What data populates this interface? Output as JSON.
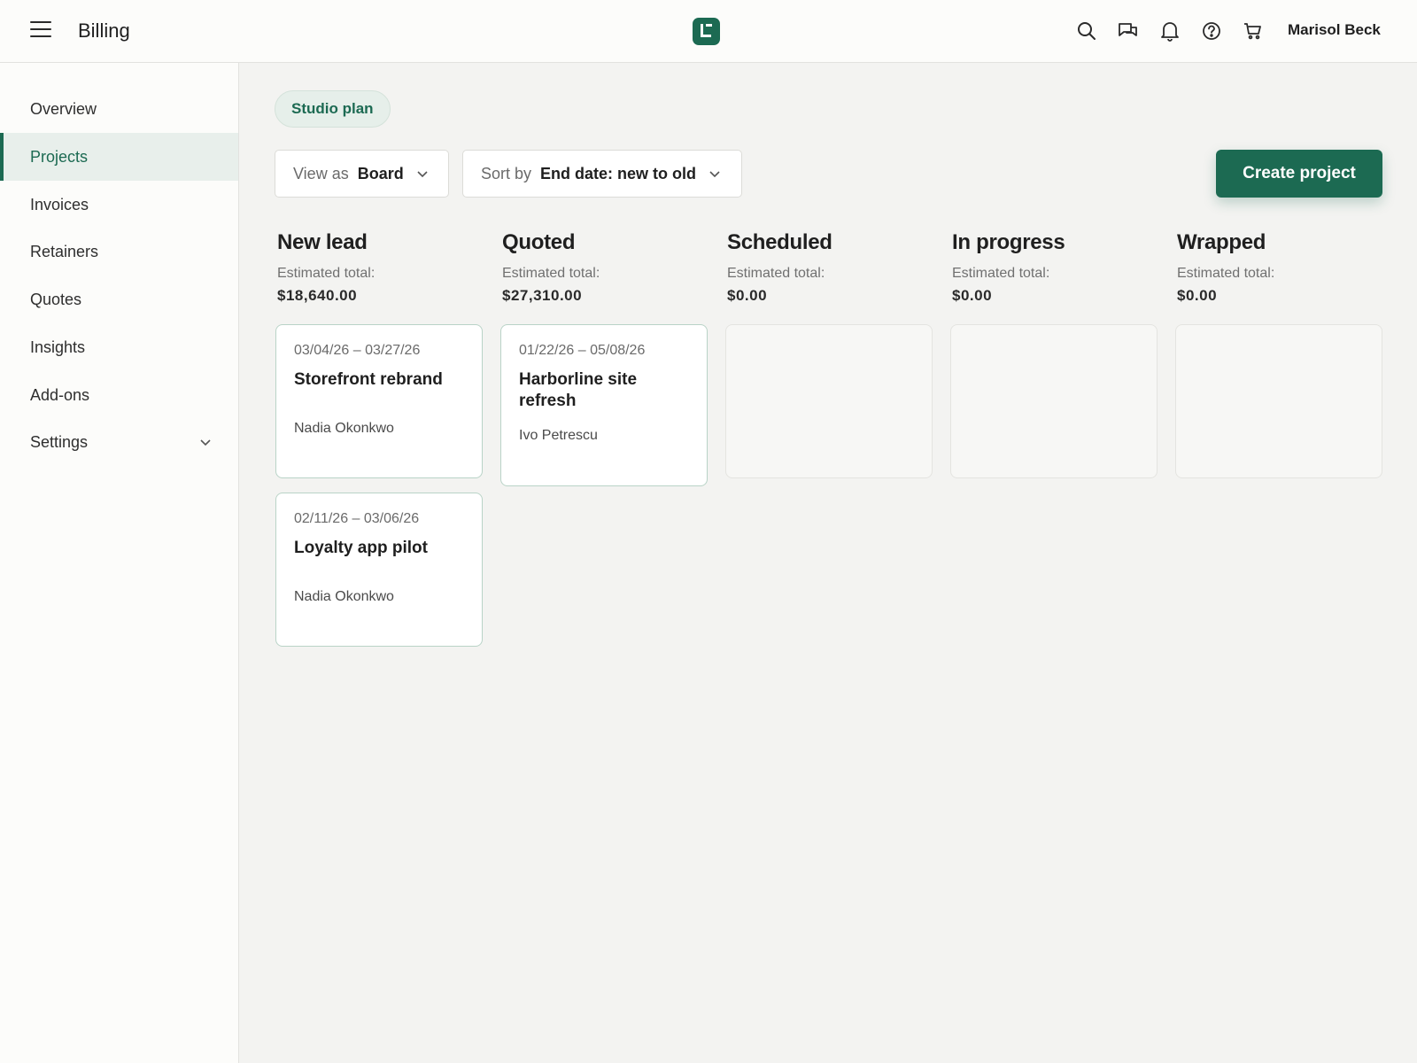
{
  "header": {
    "title": "Billing",
    "user_name": "Marisol Beck",
    "icons": [
      "search-icon",
      "chat-icon",
      "bell-icon",
      "help-icon",
      "cart-icon"
    ]
  },
  "sidebar": {
    "items": [
      {
        "label": "Overview"
      },
      {
        "label": "Projects"
      },
      {
        "label": "Invoices"
      },
      {
        "label": "Retainers"
      },
      {
        "label": "Quotes"
      },
      {
        "label": "Insights"
      },
      {
        "label": "Add-ons"
      },
      {
        "label": "Settings"
      }
    ],
    "active": "Projects"
  },
  "plan_badge": "Studio plan",
  "toolbar": {
    "view_prefix": "View as",
    "view_value": "Board",
    "sort_prefix": "Sort by",
    "sort_value": "End date: new to old",
    "create_label": "Create project"
  },
  "board": {
    "estimate_label": "Estimated total:",
    "columns": [
      {
        "title": "New lead",
        "total": "$18,640.00",
        "cards": [
          {
            "dates": "03/04/26 – 03/27/26",
            "name": "Storefront rebrand",
            "owner": "Nadia Okonkwo"
          },
          {
            "dates": "02/11/26 – 03/06/26",
            "name": "Loyalty app pilot",
            "owner": "Nadia Okonkwo"
          }
        ]
      },
      {
        "title": "Quoted",
        "total": "$27,310.00",
        "cards": [
          {
            "dates": "01/22/26 – 05/08/26",
            "name": "Harborline site refresh",
            "owner": "Ivo Petrescu"
          }
        ]
      },
      {
        "title": "Scheduled",
        "total": "$0.00",
        "cards": []
      },
      {
        "title": "In progress",
        "total": "$0.00",
        "cards": []
      },
      {
        "title": "Wrapped",
        "total": "$0.00",
        "cards": []
      }
    ]
  },
  "colors": {
    "brand": "#1c6a52",
    "active_nav_bg": "#e8efeb",
    "card_border": "#b9d3c7"
  }
}
